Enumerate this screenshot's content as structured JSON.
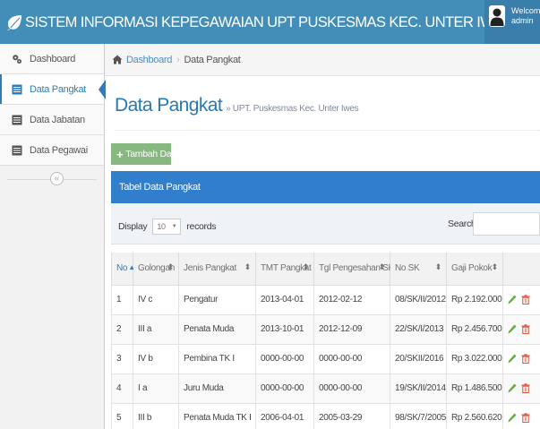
{
  "header": {
    "app_title": "SISTEM INFORMASI KEPEGAWAIAN UPT PUSKESMAS KEC. UNTER IWES",
    "welcome": "Welcome,",
    "username": "admin"
  },
  "sidebar": {
    "items": [
      {
        "label": "Dashboard",
        "icon": "dashboard-icon"
      },
      {
        "label": "Data Pangkat",
        "icon": "list-icon",
        "active": true
      },
      {
        "label": "Data Jabatan",
        "icon": "list-icon"
      },
      {
        "label": "Data Pegawai",
        "icon": "list-icon"
      }
    ],
    "collapse_glyph": "«"
  },
  "breadcrumb": {
    "home": "Dashboard",
    "separator": "›",
    "current": "Data Pangkat"
  },
  "page": {
    "title": "Data Pangkat",
    "subtitle": "» UPT. Puskesmas Kec. Unter Iwes"
  },
  "toolbar": {
    "add_label": "Tambah Data"
  },
  "table": {
    "header_title": "Tabel Data Pangkat",
    "display_prefix": "Display",
    "display_value": "10",
    "display_suffix": "records",
    "search_label": "Search:",
    "search_value": "",
    "columns": [
      "No",
      "Golongan",
      "Jenis Pangkat",
      "TMT Pangkat",
      "Tgl Pengesahan SK",
      "No SK",
      "Gaji Pokok",
      ""
    ],
    "sort_asc_glyph": "▲",
    "sort_glyph": "⬍",
    "rows": [
      {
        "no": "1",
        "golongan": "IV c",
        "jenis": "Pengatur",
        "tmt": "2013-04-01",
        "tgl": "2012-02-12",
        "nosk": "08/SK/II/2012",
        "gaji": "Rp 2.192.000"
      },
      {
        "no": "2",
        "golongan": "III a",
        "jenis": "Penata Muda",
        "tmt": "2013-10-01",
        "tgl": "2012-12-09",
        "nosk": "22/SK/I/2013",
        "gaji": "Rp 2.456.700"
      },
      {
        "no": "3",
        "golongan": "IV b",
        "jenis": "Pembina TK I",
        "tmt": "0000-00-00",
        "tgl": "0000-00-00",
        "nosk": "20/SKII/2016",
        "gaji": "Rp 3.022.000"
      },
      {
        "no": "4",
        "golongan": "I a",
        "jenis": "Juru Muda",
        "tmt": "0000-00-00",
        "tgl": "0000-00-00",
        "nosk": "19/SK/II/2014",
        "gaji": "Rp 1.486.500"
      },
      {
        "no": "5",
        "golongan": "III b",
        "jenis": "Penata Muda TK I",
        "tmt": "2006-04-01",
        "tgl": "2005-03-29",
        "nosk": "98/SK/7/2005",
        "gaji": "Rp 2.560.620"
      }
    ]
  },
  "colors": {
    "navbar": "#438eb9",
    "accent": "#307ecc",
    "add_button": "#87b87f",
    "edit_icon": "#69aa46",
    "delete_icon": "#dd5a43"
  }
}
